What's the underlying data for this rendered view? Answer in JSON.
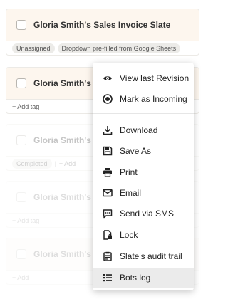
{
  "cards": [
    {
      "title": "Gloria Smith's Sales Invoice Slate",
      "tags": [
        "Unassigned",
        "Dropdown pre-filled from Google Sheets"
      ]
    },
    {
      "title": "Gloria Smith's Tra",
      "add_tag": "+ Add tag"
    },
    {
      "title": "Gloria Smith's Tra",
      "status": "Completed",
      "add_tag": "+ Add"
    },
    {
      "title": "Gloria Smith's Tra",
      "add_tag": "+ Add tag"
    },
    {
      "title": "Gloria Smith's Tra",
      "add_tag": "+ Add"
    }
  ],
  "menu": {
    "items": [
      {
        "label": "View last Revision",
        "icon": "eye-icon"
      },
      {
        "label": "Mark as Incoming",
        "icon": "record-icon"
      },
      {
        "label": "Download",
        "icon": "download-icon"
      },
      {
        "label": "Save As",
        "icon": "floppy-icon"
      },
      {
        "label": "Print",
        "icon": "printer-icon"
      },
      {
        "label": "Email",
        "icon": "envelope-icon"
      },
      {
        "label": "Send via SMS",
        "icon": "chat-icon"
      },
      {
        "label": "Lock",
        "icon": "lock-icon"
      },
      {
        "label": "Slate's audit trail",
        "icon": "clipboard-icon"
      },
      {
        "label": "Bots log",
        "icon": "list-icon"
      }
    ],
    "highlighted": "Bots log"
  }
}
